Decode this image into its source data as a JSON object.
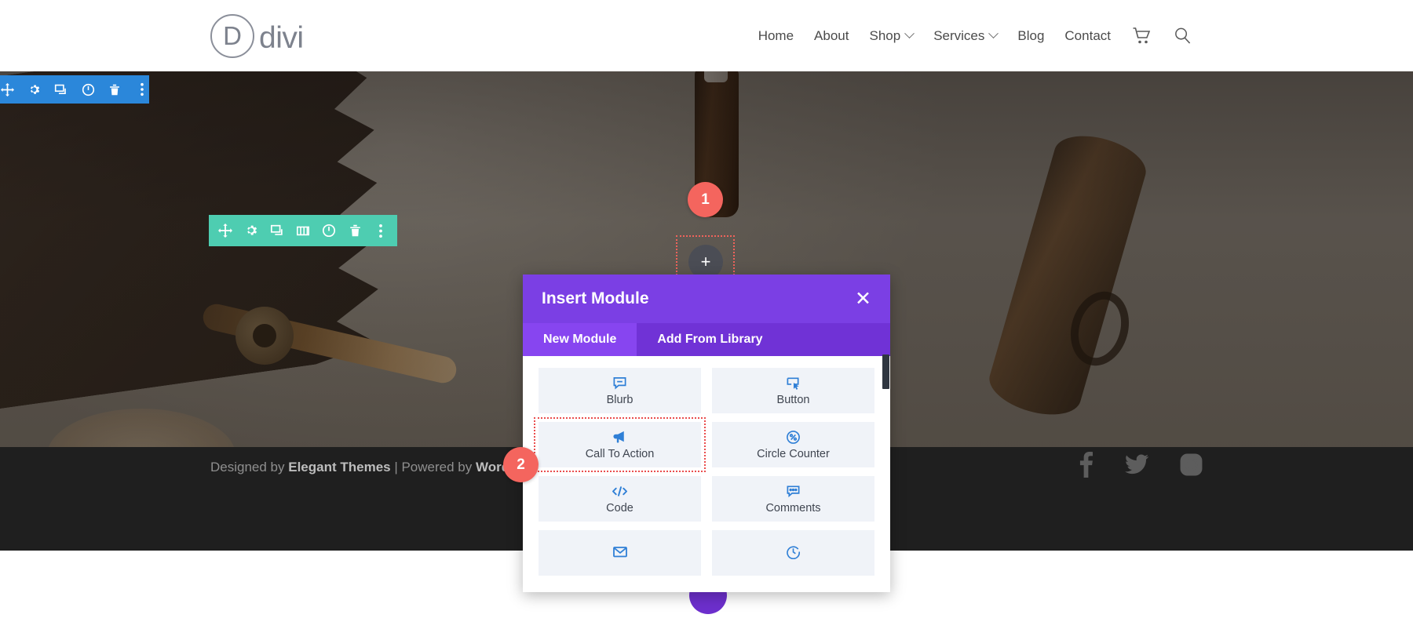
{
  "header": {
    "logo_letter": "D",
    "logo_text": "divi",
    "nav": [
      {
        "label": "Home",
        "has_caret": false
      },
      {
        "label": "About",
        "has_caret": false
      },
      {
        "label": "Shop",
        "has_caret": true
      },
      {
        "label": "Services",
        "has_caret": true
      },
      {
        "label": "Blog",
        "has_caret": false
      },
      {
        "label": "Contact",
        "has_caret": false
      }
    ],
    "cart_icon": "shopping-cart-icon",
    "search_icon": "search-icon"
  },
  "section_toolbar": {
    "color": "#2b87da",
    "icons": [
      "move-icon",
      "gear-icon",
      "duplicate-icon",
      "power-icon",
      "trash-icon",
      "more-options-icon"
    ]
  },
  "row_toolbar": {
    "color": "#4ecdb1",
    "icons": [
      "move-icon",
      "gear-icon",
      "duplicate-icon",
      "columns-icon",
      "power-icon",
      "trash-icon",
      "more-options-icon"
    ]
  },
  "add_module_slot": {
    "plus_glyph": "+",
    "outline_color": "#f0635b"
  },
  "steps": [
    {
      "number": "1"
    },
    {
      "number": "2"
    }
  ],
  "modal": {
    "title": "Insert Module",
    "close_label": "✕",
    "header_color": "#7b3fe4",
    "tabs": [
      {
        "label": "New Module",
        "active": true
      },
      {
        "label": "Add From Library",
        "active": false
      }
    ],
    "modules": [
      {
        "label": "Blurb",
        "icon": "blurb-icon",
        "highlight": false
      },
      {
        "label": "Button",
        "icon": "button-icon",
        "highlight": false
      },
      {
        "label": "Call To Action",
        "icon": "megaphone-icon",
        "highlight": true
      },
      {
        "label": "Circle Counter",
        "icon": "circle-counter-icon",
        "highlight": false
      },
      {
        "label": "Code",
        "icon": "code-icon",
        "highlight": false
      },
      {
        "label": "Comments",
        "icon": "comments-icon",
        "highlight": false
      },
      {
        "label": "",
        "icon": "email-optin-icon",
        "highlight": false
      },
      {
        "label": "",
        "icon": "countdown-timer-icon",
        "highlight": false
      }
    ]
  },
  "footer": {
    "text_prefix": "Designed by ",
    "brand_1": "Elegant Themes",
    "separator": " | Powered by ",
    "brand_2": "WordPress",
    "social": [
      "facebook-icon",
      "twitter-icon",
      "instagram-icon"
    ]
  }
}
